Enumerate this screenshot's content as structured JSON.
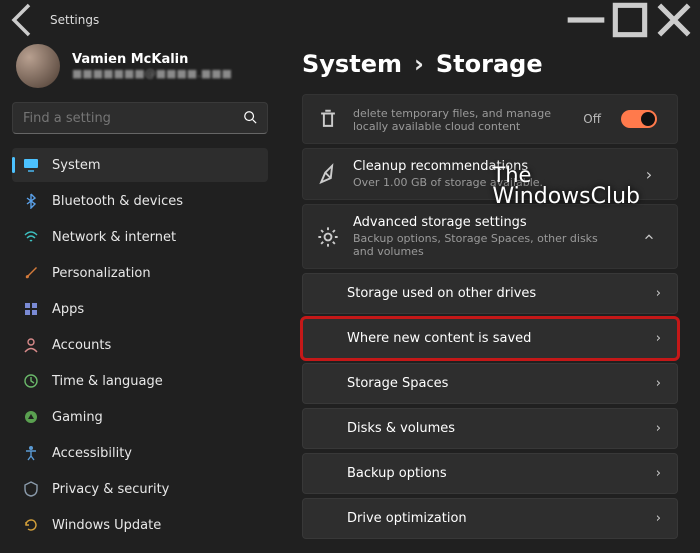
{
  "window": {
    "title": "Settings",
    "user": {
      "name": "Vamien McKalin",
      "email": "■■■■■■■@■■■■.■■■"
    },
    "search_placeholder": "Find a setting"
  },
  "sidebar": {
    "items": [
      {
        "label": "System"
      },
      {
        "label": "Bluetooth & devices"
      },
      {
        "label": "Network & internet"
      },
      {
        "label": "Personalization"
      },
      {
        "label": "Apps"
      },
      {
        "label": "Accounts"
      },
      {
        "label": "Time & language"
      },
      {
        "label": "Gaming"
      },
      {
        "label": "Accessibility"
      },
      {
        "label": "Privacy & security"
      },
      {
        "label": "Windows Update"
      }
    ]
  },
  "breadcrumb": {
    "parent": "System",
    "current": "Storage"
  },
  "cards": {
    "sense": {
      "sub": "delete temporary files, and manage locally available cloud content",
      "toggle_label": "Off"
    },
    "cleanup": {
      "title": "Cleanup recommendations",
      "sub": "Over 1.00 GB of storage available."
    },
    "advanced": {
      "title": "Advanced storage settings",
      "sub": "Backup options, Storage Spaces, other disks and volumes"
    }
  },
  "subitems": [
    {
      "label": "Storage used on other drives"
    },
    {
      "label": "Where new content is saved"
    },
    {
      "label": "Storage Spaces"
    },
    {
      "label": "Disks & volumes"
    },
    {
      "label": "Backup options"
    },
    {
      "label": "Drive optimization"
    }
  ],
  "watermark": {
    "l1": "The",
    "l2": "WindowsClub"
  }
}
